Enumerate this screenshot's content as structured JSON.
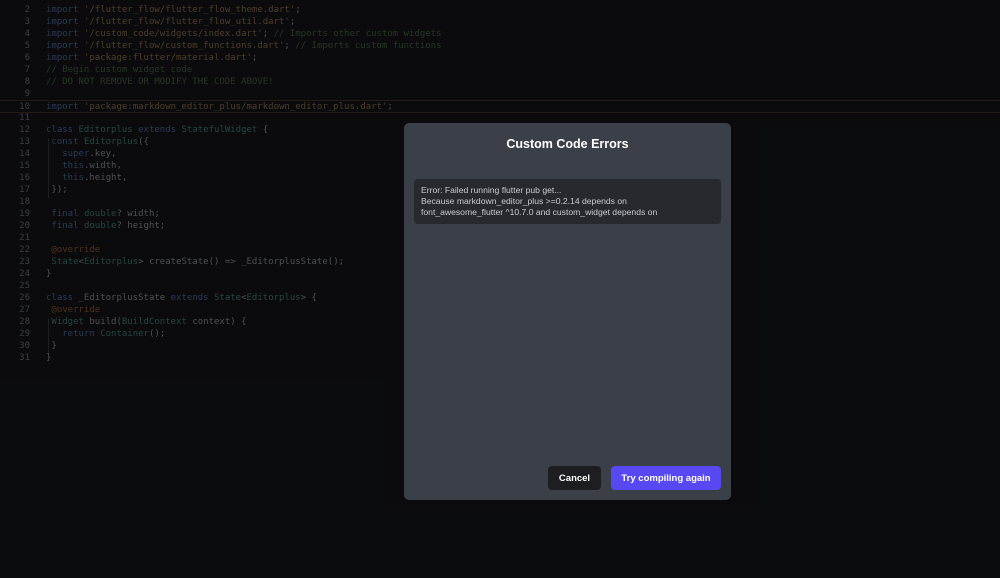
{
  "editor": {
    "lines": [
      {
        "n": "2",
        "tokens": [
          [
            "kw",
            "import "
          ],
          [
            "str",
            "'/flutter_flow/flutter_flow_theme.dart'"
          ],
          [
            "",
            "; "
          ]
        ]
      },
      {
        "n": "3",
        "tokens": [
          [
            "kw",
            "import "
          ],
          [
            "str",
            "'/flutter_flow/flutter_flow_util.dart'"
          ],
          [
            "",
            ";"
          ]
        ]
      },
      {
        "n": "4",
        "tokens": [
          [
            "kw",
            "import "
          ],
          [
            "str",
            "'/custom_code/widgets/index.dart'"
          ],
          [
            "",
            "; "
          ],
          [
            "cm",
            "// Imports other custom widgets"
          ]
        ]
      },
      {
        "n": "5",
        "tokens": [
          [
            "kw",
            "import "
          ],
          [
            "str",
            "'/flutter_flow/custom_functions.dart'"
          ],
          [
            "",
            "; "
          ],
          [
            "cm",
            "// Imports custom functions"
          ]
        ]
      },
      {
        "n": "6",
        "tokens": [
          [
            "kw",
            "import "
          ],
          [
            "str",
            "'package:flutter/material.dart'"
          ],
          [
            "",
            ";"
          ]
        ]
      },
      {
        "n": "7",
        "tokens": [
          [
            "cm",
            "// Begin custom widget code"
          ]
        ]
      },
      {
        "n": "8",
        "tokens": [
          [
            "cm",
            "// DO NOT REMOVE OR MODIFY THE CODE ABOVE!"
          ]
        ]
      },
      {
        "n": "9",
        "tokens": []
      },
      {
        "n": "10",
        "active": true,
        "tokens": [
          [
            "kw",
            "import "
          ],
          [
            "str",
            "'package:markdown_editor_plus/markdown_editor_plus.dart'"
          ],
          [
            "",
            ";"
          ]
        ]
      },
      {
        "n": "11",
        "tokens": []
      },
      {
        "n": "12",
        "tokens": [
          [
            "kw",
            "class "
          ],
          [
            "ty",
            "Editorplus "
          ],
          [
            "kw",
            "extends "
          ],
          [
            "ty",
            "StatefulWidget"
          ],
          [
            "",
            " {"
          ]
        ]
      },
      {
        "n": "13",
        "tokens": [
          [
            "",
            " "
          ],
          [
            "kw",
            "const "
          ],
          [
            "ty",
            "Editorplus"
          ],
          [
            "",
            "({"
          ]
        ]
      },
      {
        "n": "14",
        "tokens": [
          [
            "",
            "   "
          ],
          [
            "kw",
            "super"
          ],
          [
            "",
            ".key,"
          ]
        ]
      },
      {
        "n": "15",
        "tokens": [
          [
            "",
            "   "
          ],
          [
            "kw",
            "this"
          ],
          [
            "",
            ".width,"
          ]
        ]
      },
      {
        "n": "16",
        "tokens": [
          [
            "",
            "   "
          ],
          [
            "kw",
            "this"
          ],
          [
            "",
            ".height,"
          ]
        ]
      },
      {
        "n": "17",
        "tokens": [
          [
            "",
            " });"
          ]
        ]
      },
      {
        "n": "18",
        "tokens": []
      },
      {
        "n": "19",
        "tokens": [
          [
            "",
            " "
          ],
          [
            "kw",
            "final "
          ],
          [
            "ty",
            "double"
          ],
          [
            "",
            "? width;"
          ]
        ]
      },
      {
        "n": "20",
        "tokens": [
          [
            "",
            " "
          ],
          [
            "kw",
            "final "
          ],
          [
            "ty",
            "double"
          ],
          [
            "",
            "? height;"
          ]
        ]
      },
      {
        "n": "21",
        "tokens": []
      },
      {
        "n": "22",
        "tokens": [
          [
            "",
            " "
          ],
          [
            "an",
            "@override"
          ]
        ]
      },
      {
        "n": "23",
        "tokens": [
          [
            "",
            " "
          ],
          [
            "ty",
            "State"
          ],
          [
            "",
            "<"
          ],
          [
            "ty",
            "Editorplus"
          ],
          [
            "",
            "> createState() => _EditorplusState();"
          ]
        ]
      },
      {
        "n": "24",
        "tokens": [
          [
            "",
            "}"
          ]
        ]
      },
      {
        "n": "25",
        "tokens": []
      },
      {
        "n": "26",
        "tokens": [
          [
            "kw",
            "class "
          ],
          [
            "",
            "_EditorplusState "
          ],
          [
            "kw",
            "extends "
          ],
          [
            "ty",
            "State"
          ],
          [
            "",
            "<"
          ],
          [
            "ty",
            "Editorplus"
          ],
          [
            "",
            "> {"
          ]
        ]
      },
      {
        "n": "27",
        "tokens": [
          [
            "",
            " "
          ],
          [
            "an",
            "@override"
          ]
        ]
      },
      {
        "n": "28",
        "tokens": [
          [
            "",
            " "
          ],
          [
            "ty",
            "Widget "
          ],
          [
            "",
            "build("
          ],
          [
            "ty",
            "BuildContext"
          ],
          [
            "",
            " context) {"
          ]
        ]
      },
      {
        "n": "29",
        "tokens": [
          [
            "",
            "   "
          ],
          [
            "kw",
            "return "
          ],
          [
            "ty",
            "Container"
          ],
          [
            "",
            "();"
          ]
        ]
      },
      {
        "n": "30",
        "tokens": [
          [
            "",
            " }"
          ]
        ]
      },
      {
        "n": "31",
        "tokens": [
          [
            "",
            "}"
          ]
        ]
      }
    ]
  },
  "dialog": {
    "title": "Custom Code Errors",
    "error_lines": [
      "Error: Failed running flutter pub get...",
      "Because markdown_editor_plus >=0.2.14 depends on",
      "font_awesome_flutter ^10.7.0 and custom_widget depends on"
    ],
    "cancel_label": "Cancel",
    "retry_label": "Try compiling again"
  },
  "colors": {
    "background": "#111215",
    "dialog": "#3b4048",
    "error_box": "#26292e",
    "primary_button": "#5848f2",
    "cancel_button": "#1c1e22"
  }
}
